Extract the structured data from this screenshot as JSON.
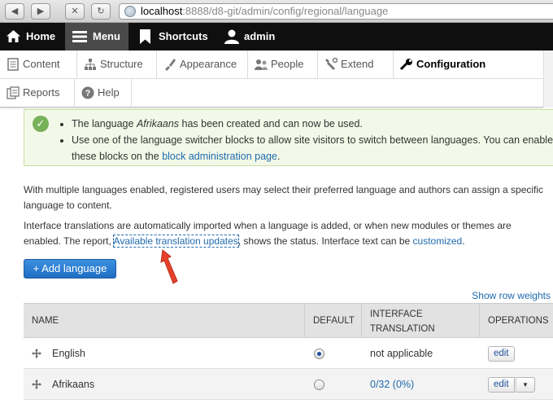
{
  "browser": {
    "back_icon": "◀",
    "forward_icon": "▶",
    "stop_icon": "✕",
    "reload_icon": "↻",
    "url_host": "localhost",
    "url_rest": ":8888/d8-git/admin/config/regional/language"
  },
  "toolbar": {
    "home": "Home",
    "menu": "Menu",
    "shortcuts": "Shortcuts",
    "user": "admin"
  },
  "tray": {
    "items": [
      {
        "label": "Content",
        "icon": "content-icon"
      },
      {
        "label": "Structure",
        "icon": "structure-icon"
      },
      {
        "label": "Appearance",
        "icon": "appearance-icon"
      },
      {
        "label": "People",
        "icon": "people-icon"
      },
      {
        "label": "Extend",
        "icon": "extend-icon"
      },
      {
        "label": "Configuration",
        "icon": "configuration-icon",
        "active": true
      },
      {
        "label": "Reports",
        "icon": "reports-icon"
      },
      {
        "label": "Help",
        "icon": "help-icon"
      }
    ]
  },
  "status": {
    "msg1_pre": "The language ",
    "msg1_em": "Afrikaans",
    "msg1_post": " has been created and can now be used.",
    "msg2_pre": "Use one of the language switcher blocks to allow site visitors to switch between languages. You can enable these blocks on the ",
    "msg2_link": "block administration page",
    "msg2_post": "."
  },
  "intro": {
    "para1": "With multiple languages enabled, registered users may select their preferred language and authors can assign a specific language to content.",
    "para2_pre": "Interface translations are automatically imported when a language is added, or when new modules or themes are enabled. The report, ",
    "para2_link": "Available translation updates",
    "para2_mid": ", shows the status. Interface text can be ",
    "para2_link2": "customized",
    "para2_post": "."
  },
  "add_button": "+ Add language",
  "show_row_weights": "Show row weights",
  "table": {
    "headers": {
      "name": "NAME",
      "default": "DEFAULT",
      "interface_line1": "INTERFACE",
      "interface_line2": "TRANSLATION",
      "operations": "OPERATIONS"
    },
    "rows": [
      {
        "name": "English",
        "default": true,
        "translation": "not applicable",
        "op": "edit"
      },
      {
        "name": "Afrikaans",
        "default": false,
        "translation": "0/32 (0%)",
        "op": "edit"
      }
    ]
  },
  "colors": {
    "link": "#1f6ab0",
    "toolbar_bg": "#0f0f0f",
    "status_bg": "#f3f9e8",
    "primary_button": "#1e6fc4",
    "annotation_arrow": "#e8402a"
  }
}
